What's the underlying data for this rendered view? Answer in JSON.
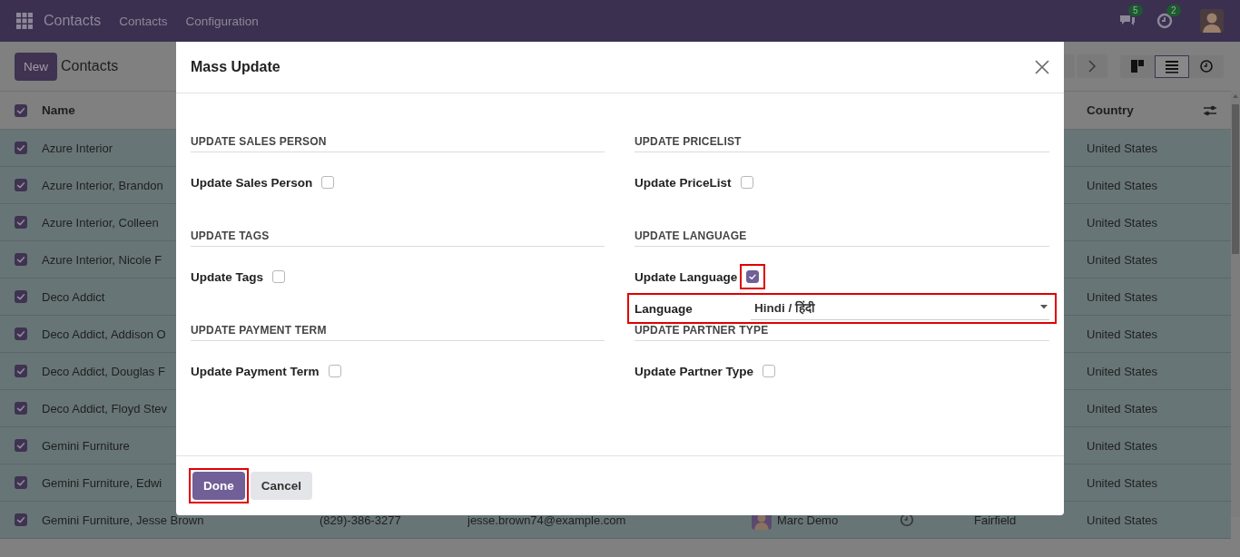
{
  "top_bar": {
    "app_name": "Contacts",
    "menu": [
      "Contacts",
      "Configuration"
    ],
    "messages_badge": "5",
    "activities_badge": "2"
  },
  "control_panel": {
    "new_button": "New",
    "breadcrumb": "Contacts",
    "views": [
      {
        "kind": "kanban",
        "selected": false
      },
      {
        "kind": "list",
        "selected": true
      },
      {
        "kind": "activity",
        "selected": false
      }
    ]
  },
  "list": {
    "all_selected": true,
    "columns": [
      "Name",
      "Country"
    ],
    "rows": [
      {
        "selected": true,
        "name": "Azure Interior",
        "country": "United States"
      },
      {
        "selected": true,
        "name": "Azure Interior, Brandon",
        "country": "United States"
      },
      {
        "selected": true,
        "name": "Azure Interior, Colleen",
        "country": "United States"
      },
      {
        "selected": true,
        "name": "Azure Interior, Nicole F",
        "country": "United States"
      },
      {
        "selected": true,
        "name": "Deco Addict",
        "country": "United States"
      },
      {
        "selected": true,
        "name": "Deco Addict, Addison O",
        "country": "United States"
      },
      {
        "selected": true,
        "name": "Deco Addict, Douglas F",
        "country": "United States"
      },
      {
        "selected": true,
        "name": "Deco Addict, Floyd Stev",
        "country": "United States"
      },
      {
        "selected": true,
        "name": "Gemini Furniture",
        "country": "United States"
      },
      {
        "selected": true,
        "name": "Gemini Furniture, Edwi",
        "country": "United States"
      },
      {
        "selected": true,
        "name": "Gemini Furniture, Jesse Brown",
        "phone": "(829)-386-3277",
        "email": "jesse.brown74@example.com",
        "salesperson": "Marc Demo",
        "city": "Fairfield",
        "country": "United States"
      }
    ]
  },
  "dialog": {
    "title": "Mass Update",
    "sections": [
      {
        "heading": "UPDATE SALES PERSON",
        "toggle": {
          "label": "Update Sales Person",
          "checked": false,
          "highlighted": false
        }
      },
      {
        "heading": "UPDATE PRICELIST",
        "toggle": {
          "label": "Update PriceList",
          "checked": false,
          "highlighted": false
        }
      },
      {
        "heading": "UPDATE TAGS",
        "toggle": {
          "label": "Update Tags",
          "checked": false,
          "highlighted": false
        }
      },
      {
        "heading": "UPDATE LANGUAGE",
        "toggle": {
          "label": "Update Language",
          "checked": true,
          "highlighted": true
        },
        "field": {
          "label": "Language",
          "value": "Hindi / हिंदी",
          "highlighted": true
        }
      },
      {
        "heading": "UPDATE PAYMENT TERM",
        "toggle": {
          "label": "Update Payment Term",
          "checked": false,
          "highlighted": false
        }
      },
      {
        "heading": "UPDATE PARTNER TYPE",
        "toggle": {
          "label": "Update Partner Type",
          "checked": false,
          "highlighted": false
        }
      }
    ],
    "buttons": [
      {
        "label": "Done",
        "kind": "primary",
        "highlighted": true
      },
      {
        "label": "Cancel",
        "kind": "secondary",
        "highlighted": false
      }
    ]
  }
}
